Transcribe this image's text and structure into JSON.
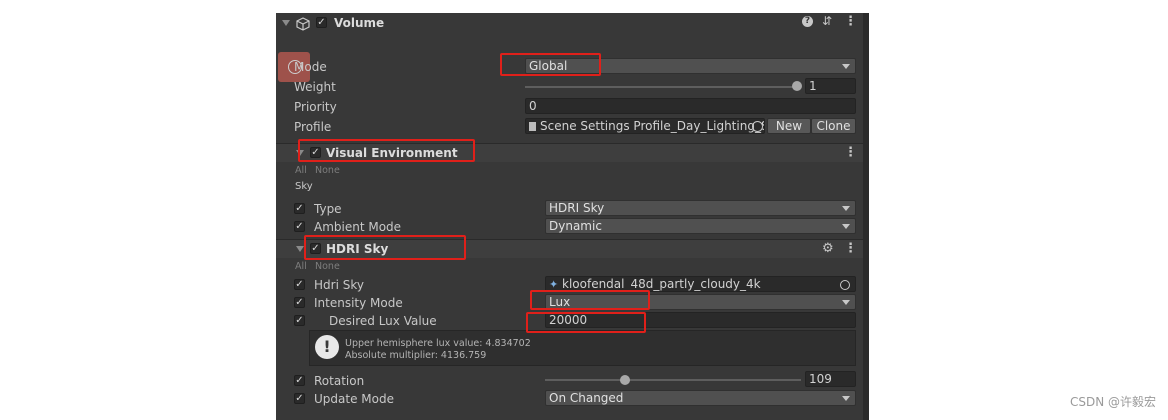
{
  "component": {
    "title": "Volume"
  },
  "volume": {
    "mode_label": "Mode",
    "mode_value": "Global",
    "weight_label": "Weight",
    "weight_value": "1",
    "weight_fraction": 1.0,
    "priority_label": "Priority",
    "priority_value": "0",
    "profile_label": "Profile",
    "profile_value": "Scene Settings Profile_Day_Lighting_S",
    "new_label": "New",
    "clone_label": "Clone"
  },
  "visual_environment": {
    "title": "Visual Environment",
    "all": "All",
    "none": "None",
    "section": "Sky",
    "type_label": "Type",
    "type_value": "HDRI Sky",
    "ambient_label": "Ambient Mode",
    "ambient_value": "Dynamic"
  },
  "hdri_sky": {
    "title": "HDRI Sky",
    "all": "All",
    "none": "None",
    "hdri_label": "Hdri Sky",
    "hdri_value": "kloofendal_48d_partly_cloudy_4k",
    "intensity_mode_label": "Intensity Mode",
    "intensity_mode_value": "Lux",
    "lux_label": "Desired Lux Value",
    "lux_value": "20000",
    "info_line1": "Upper hemisphere lux value: 4.834702",
    "info_line2": "Absolute multiplier: 4136.759",
    "rotation_label": "Rotation",
    "rotation_value": "109",
    "rotation_fraction": 0.303,
    "update_mode_label": "Update Mode",
    "update_mode_value": "On Changed"
  },
  "watermark": "CSDN @许毅宏",
  "colors": {
    "highlight": "#e0201a",
    "panel": "#383838"
  }
}
